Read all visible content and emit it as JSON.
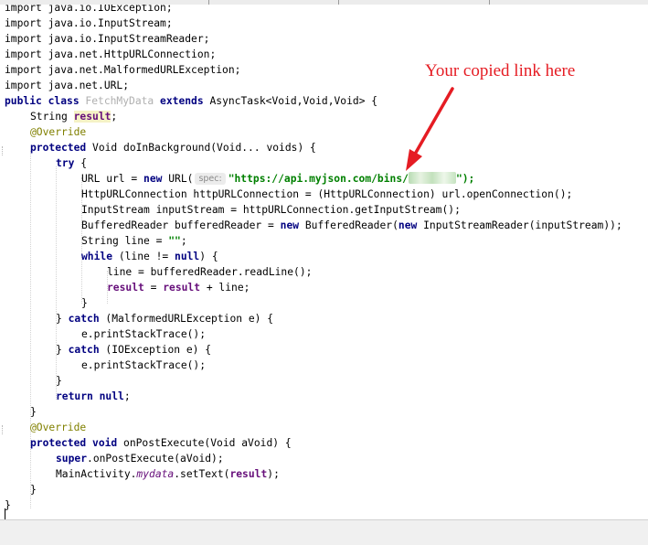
{
  "editor": {
    "lines": {
      "l00": "import java.io.IOException;",
      "l01": "import java.io.InputStream;",
      "l02": "import java.io.InputStreamReader;",
      "l03": "import java.net.HttpURLConnection;",
      "l04": "import java.net.MalformedURLException;",
      "l05": "import java.net.URL;",
      "l06a": "public class ",
      "l06b": "FetchMyData",
      "l06c": " extends ",
      "l06d": "AsyncTask<Void,Void,Void> {",
      "l07a": "String ",
      "l07b": "result",
      "l07c": ";",
      "l08": "@Override",
      "l09a": "protected ",
      "l09b": "Void doInBackground(Void... voids) {",
      "l10a": "try",
      "l10b": " {",
      "l11a": "URL url = ",
      "l11b": "new",
      "l11c": " URL(",
      "l11hint": "spec:",
      "l11d": "\"https://api.myjson.com/bins/",
      "l11e": "\");",
      "l12": "HttpURLConnection httpURLConnection = (HttpURLConnection) url.openConnection();",
      "l13": "InputStream inputStream = httpURLConnection.getInputStream();",
      "l14a": "BufferedReader bufferedReader = ",
      "l14b": "new",
      "l14c": " BufferedReader(",
      "l14d": "new",
      "l14e": " InputStreamReader(inputStream));",
      "l15a": "String line = ",
      "l15b": "\"\"",
      "l15c": ";",
      "l16a": "while",
      "l16b": " (line != ",
      "l16c": "null",
      "l16d": ") {",
      "l17": "line = bufferedReader.readLine();",
      "l18a": "result",
      "l18b": " = ",
      "l18c": "result",
      "l18d": " + line;",
      "l19": "}",
      "l20a": "} ",
      "l20b": "catch",
      "l20c": " (MalformedURLException e) {",
      "l21": "e.printStackTrace();",
      "l22a": "} ",
      "l22b": "catch",
      "l22c": " (IOException e) {",
      "l23": "e.printStackTrace();",
      "l24": "}",
      "l25a": "return",
      "l25b": " null",
      "l25c": ";",
      "l26": "}",
      "l27": "@Override",
      "l28a": "protected void",
      "l28b": " onPostExecute(Void aVoid) {",
      "l29a": "super",
      "l29b": ".onPostExecute(aVoid);",
      "l30a": "MainActivity.",
      "l30b": "mydata",
      "l30c": ".setText(",
      "l30d": "result",
      "l30e": ");",
      "l31": "}",
      "l32": "}"
    }
  },
  "annotation": {
    "text": "Your copied link here",
    "color": "#e51c23"
  },
  "colors": {
    "keyword": "#000080",
    "field": "#660e7a",
    "string": "#008000",
    "annotation": "#808000"
  }
}
